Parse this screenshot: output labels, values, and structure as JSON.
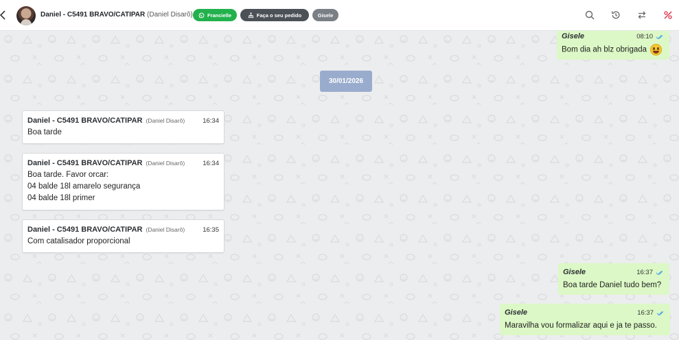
{
  "header": {
    "contact_name": "Daniel - C5491 BRAVO/CATIPAR",
    "contact_sub": "(Daniel Disarô)",
    "chips": {
      "whatsapp": "Francielle",
      "order": "Faça o seu pedido",
      "agent": "Gisele"
    },
    "icons": [
      "back-icon",
      "search-icon",
      "history-icon",
      "transfer-icon",
      "tag-off-icon"
    ],
    "colors": {
      "whatsapp_chip": "#22b14c",
      "order_chip": "#4c5158",
      "agent_chip": "#7a7f86",
      "accent_red": "#e0344b"
    }
  },
  "chat": {
    "date_separator": "30/01/2026",
    "messages": [
      {
        "direction": "out",
        "sender": "Gisele",
        "time": "08:10",
        "lines": [
          "Bom dia ah blz obrigada"
        ],
        "emoji": "grinning-face",
        "status": "read"
      },
      {
        "direction": "in",
        "sender": "Daniel - C5491 BRAVO/CATIPAR",
        "sender_sub": "(Daniel Disarô)",
        "time": "16:34",
        "lines": [
          "Boa tarde"
        ]
      },
      {
        "direction": "in",
        "sender": "Daniel - C5491 BRAVO/CATIPAR",
        "sender_sub": "(Daniel Disarô)",
        "time": "16:34",
        "lines": [
          "Boa tarde. Favor orcar:",
          "04 balde 18l amarelo segurança",
          "04 balde 18l primer"
        ]
      },
      {
        "direction": "in",
        "sender": "Daniel - C5491 BRAVO/CATIPAR",
        "sender_sub": "(Daniel Disarô)",
        "time": "16:35",
        "lines": [
          "Com catalisador proporcional"
        ]
      },
      {
        "direction": "out",
        "sender": "Gisele",
        "time": "16:37",
        "lines": [
          "Boa tarde Daniel tudo bem?"
        ],
        "status": "read"
      },
      {
        "direction": "out",
        "sender": "Gisele",
        "time": "16:37",
        "lines": [
          "Maravilha vou formalizar aqui e ja te passo."
        ],
        "status": "read"
      }
    ],
    "colors": {
      "incoming_bubble": "#ffffff",
      "outgoing_bubble": "#dcf8c6",
      "date_pill": "#9aaccd",
      "read_ticks": "#4fa9e8"
    }
  }
}
